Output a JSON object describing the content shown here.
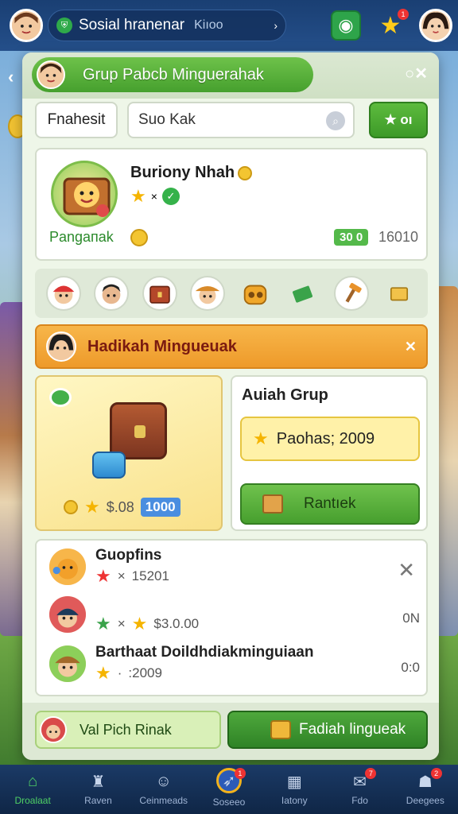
{
  "topbar": {
    "title": "Sosial hranenar",
    "title_suffix": "Kiıoo",
    "chevron": "›",
    "icons": [
      "user-badge-icon",
      "star-icon"
    ],
    "star_badge": "1"
  },
  "modal": {
    "header_title": "Grup Pabcb Minguerahak",
    "close_label": "○✕",
    "filter_label": "Fnahesit",
    "search_value": "Suo Kak",
    "star_button_label": "★ oı",
    "profile": {
      "name": "Buriony Nhah",
      "role": "Pangaпak",
      "badge": "30 0",
      "count": "16010"
    },
    "strip_icons": [
      "avatar-red-cap",
      "avatar-boy",
      "chest-icon",
      "avatar-hat",
      "coin-bag-icon",
      "cash-icon",
      "hammer-icon",
      "box-icon"
    ],
    "banner_title": "Hadikah Mingueuak",
    "banner_close": "✕",
    "reward": {
      "price": "$.08",
      "badge": "1000"
    },
    "group": {
      "title": "Auiah Grup",
      "price_label": "Paohas; 2009",
      "claim_label": "Rantıek"
    },
    "members": [
      {
        "name": "Guopfins",
        "stat": "15201",
        "right": ""
      },
      {
        "name": "",
        "stat": "$3.0.00",
        "right": "0N"
      },
      {
        "name": "Barthaat Doildhdiakminguiaan",
        "stat": ":2009",
        "right": "0:0"
      }
    ],
    "members_close": "✕",
    "footer_left_label": "Val Pich Rinak",
    "footer_right_label": "Fadiah lingueak"
  },
  "nav": [
    {
      "label": "Droalaat",
      "icon": "home-icon",
      "active": true,
      "badge": ""
    },
    {
      "label": "Raven",
      "icon": "castle-icon",
      "active": false,
      "badge": ""
    },
    {
      "label": "Ceinmeads",
      "icon": "face-icon",
      "active": false,
      "badge": ""
    },
    {
      "label": "Soseeo",
      "icon": "compass-icon",
      "active": false,
      "badge": "1"
    },
    {
      "label": "Iatony",
      "icon": "grid-icon",
      "active": false,
      "badge": ""
    },
    {
      "label": "Fdo",
      "icon": "mail-icon",
      "active": false,
      "badge": "7"
    },
    {
      "label": "Deegees",
      "icon": "bag-icon",
      "active": false,
      "badge": "2"
    }
  ],
  "colors": {
    "accent_green": "#46a02e",
    "banner_orange": "#ee9a2a",
    "nav_bg": "#0f2646"
  }
}
